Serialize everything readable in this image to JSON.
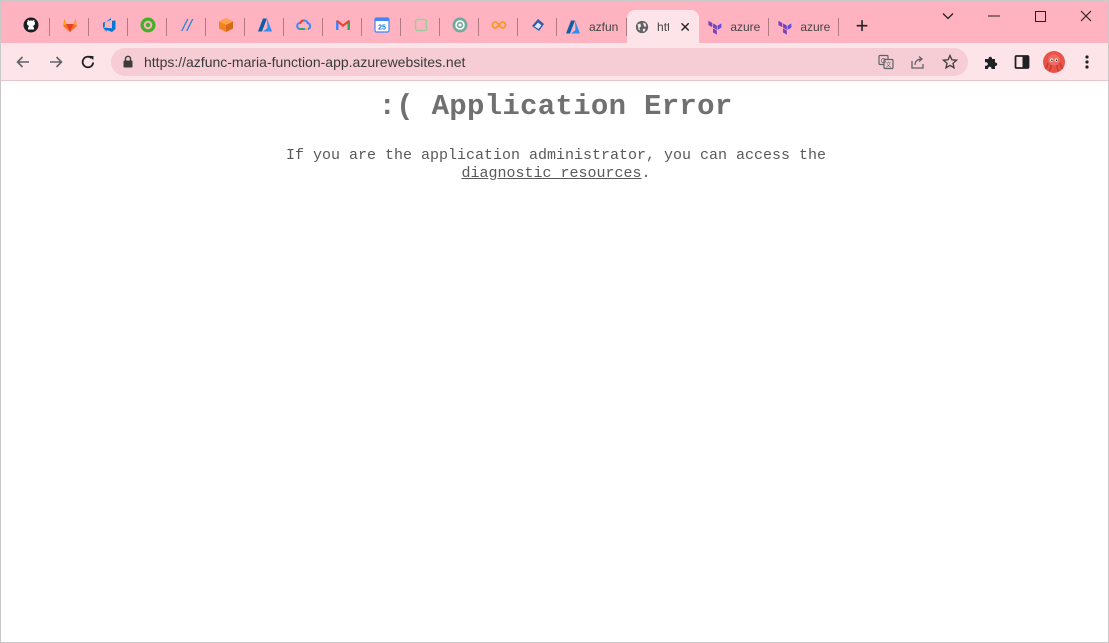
{
  "browser": {
    "pinned_tabs": [
      {
        "icon": "github-icon"
      },
      {
        "icon": "gitlab-icon"
      },
      {
        "icon": "azure-devops-icon"
      },
      {
        "icon": "circleci-icon"
      },
      {
        "icon": "azure-pipelines-icon"
      },
      {
        "icon": "package-icon"
      },
      {
        "icon": "azure-icon"
      },
      {
        "icon": "google-cloud-icon"
      },
      {
        "icon": "gmail-icon"
      },
      {
        "icon": "calendar-icon"
      },
      {
        "icon": "extension-tab-icon"
      },
      {
        "icon": "chatgpt-icon"
      },
      {
        "icon": "infinity-icon"
      },
      {
        "icon": "cloud-app-icon"
      }
    ],
    "tabs": [
      {
        "label": "azfun",
        "icon": "azure-icon",
        "active": false
      },
      {
        "label": "htt",
        "icon": "globe-icon",
        "active": true
      },
      {
        "label": "azure",
        "icon": "terraform-icon",
        "active": false
      },
      {
        "label": "azure",
        "icon": "terraform-icon",
        "active": false
      }
    ],
    "new_tab_label": "+",
    "address_bar": {
      "url": "https://azfunc-maria-function-app.azurewebsites.net"
    }
  },
  "page": {
    "title": ":( Application Error",
    "message_before_link": "If you are the application administrator, you can access the",
    "link_text": "diagnostic resources",
    "message_after_link": "."
  },
  "colors": {
    "tab_strip": "#ffb3c0",
    "toolbar": "#fde4e8",
    "omnibox": "#f6cdd4",
    "error_title": "#707070",
    "error_text": "#595959"
  }
}
